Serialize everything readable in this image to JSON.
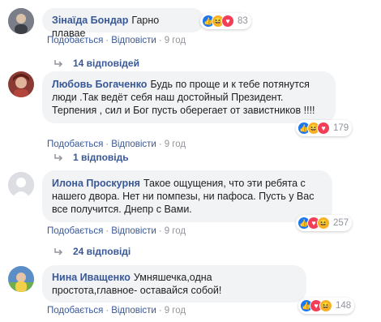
{
  "comments": [
    {
      "author": "Зінаїда Бондар",
      "text": "Гарно плавае",
      "reaction_count": "83",
      "reactions": [
        "like",
        "haha",
        "love"
      ],
      "like_label": "Подобається",
      "reply_label": "Відповісти",
      "time": "9 год",
      "replies_label": "14 відповідей"
    },
    {
      "author": "Любовь Богаченко",
      "text": "Будь по проще и к тебе потянутся люди .Так ведёт себя наш достойный Президент. Терпения , сил и Бог пусть оберегает от завистников !!!!",
      "reaction_count": "179",
      "reactions": [
        "like",
        "haha",
        "love"
      ],
      "like_label": "Подобається",
      "reply_label": "Відповісти",
      "time": "9 год",
      "replies_label": "1 відповідь"
    },
    {
      "author": "Илона Проскурня",
      "text": "Такое ощущения, что эти ребята с нашего двора. Нет ни помпезы, ни пафоса. Пусть у Вас все получится. Днепр с Вами.",
      "reaction_count": "257",
      "reactions": [
        "like",
        "love",
        "haha"
      ],
      "like_label": "Подобається",
      "reply_label": "Відповісти",
      "time": "9 год",
      "replies_label": "24 відповіді"
    },
    {
      "author": "Нина Иващенко",
      "text": "Умняшечка,одна простота,главное- оставайся собой!",
      "reaction_count": "148",
      "reactions": [
        "like",
        "love",
        "haha"
      ],
      "like_label": "Подобається",
      "reply_label": "Відповісти",
      "time": "9 год"
    }
  ],
  "colors": {
    "link": "#385898",
    "bubble": "#f2f3f5",
    "meta": "#90949c",
    "like": "#1877f2",
    "haha": "#f7b125",
    "love": "#f33e58"
  }
}
